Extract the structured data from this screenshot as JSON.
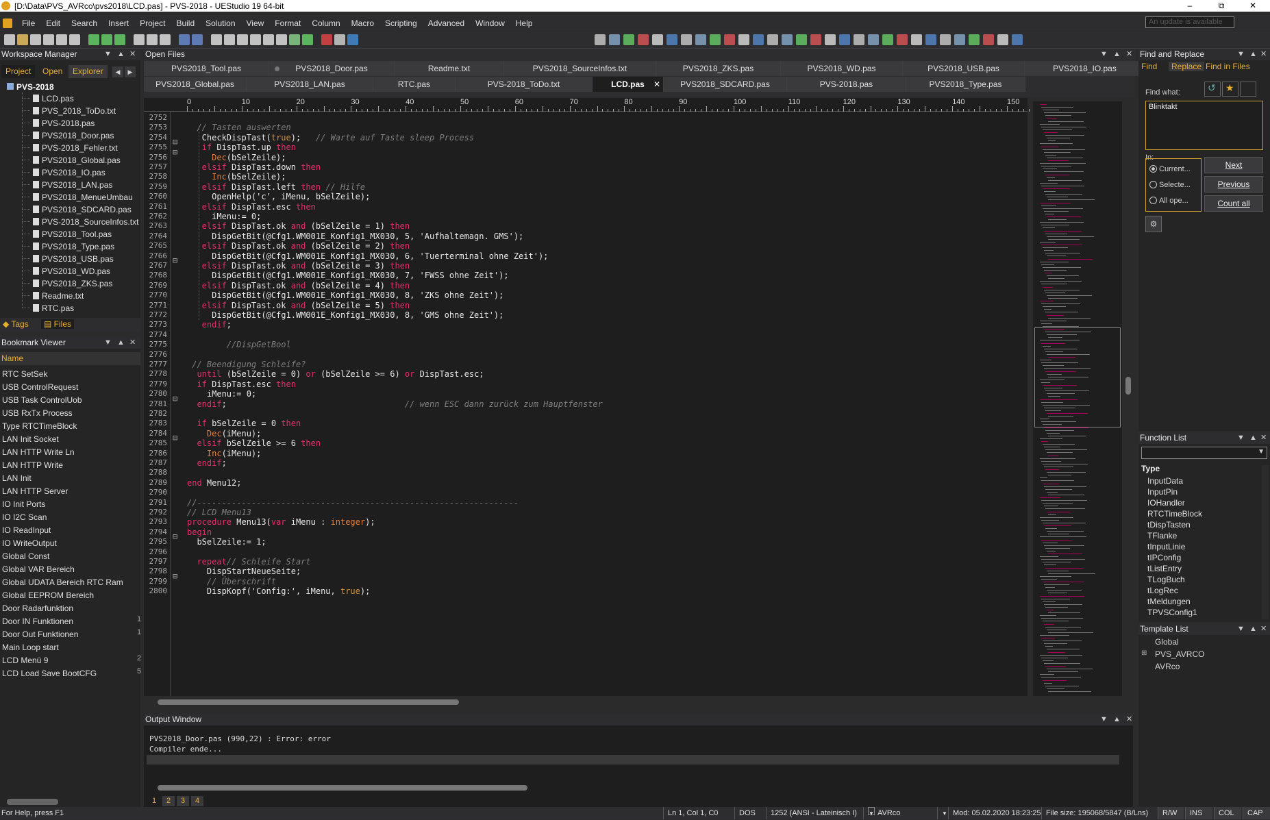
{
  "window": {
    "title": "[D:\\Data\\PVS_AVRco\\pvs2018\\LCD.pas] - PVS-2018 - UEStudio 19 64-bit",
    "banner": "An update is available"
  },
  "menu": [
    "File",
    "Edit",
    "Search",
    "Insert",
    "Project",
    "Build",
    "Solution",
    "View",
    "Format",
    "Column",
    "Macro",
    "Scripting",
    "Advanced",
    "Window",
    "Help"
  ],
  "workspace": {
    "title": "Workspace Manager",
    "tabs": [
      "Project",
      "Open",
      "Explorer"
    ],
    "root": "PVS-2018",
    "files": [
      "LCD.pas",
      "PVS_2018_ToDo.txt",
      "PVS-2018.pas",
      "PVS2018_Door.pas",
      "PVS-2018_Fehler.txt",
      "PVS2018_Global.pas",
      "PVS2018_IO.pas",
      "PVS2018_LAN.pas",
      "PVS2018_MenueUmbau",
      "PVS2018_SDCARD.pas",
      "PVS-2018_SourceInfos.txt",
      "PVS2018_Tool.pas",
      "PVS2018_Type.pas",
      "PVS2018_USB.pas",
      "PVS2018_WD.pas",
      "PVS2018_ZKS.pas",
      "Readme.txt",
      "RTC.pas"
    ],
    "bottom_tabs": [
      "Tags",
      "Files"
    ]
  },
  "bookmarks": {
    "title": "Bookmark Viewer",
    "column": "Name",
    "items": [
      "RTC SetSek",
      "USB ControlRequest",
      "USB Task ControlUob",
      "USB RxTx Process",
      "Type RTCTimeBlock",
      "LAN Init Socket",
      "LAN HTTP Write Ln",
      "LAN HTTP Write",
      "LAN Init",
      "LAN HTTP Server",
      "IO Init Ports",
      "IO I2C Scan",
      "IO ReadInput",
      "IO WriteOutput",
      "Global Const",
      "Global VAR Bereich",
      "Global UDATA Bereich RTC Ram",
      "Global EEPROM Bereich",
      "Door Radarfunktion",
      "Door IN Funktionen",
      "Door Out Funktionen",
      "Main Loop start",
      "LCD Menü 9",
      "LCD Load Save BootCFG"
    ],
    "counts": [
      "",
      "",
      "",
      "",
      "",
      "",
      "",
      "",
      "",
      "",
      "",
      "",
      "",
      "",
      "",
      "",
      "",
      "",
      "",
      "1",
      "1",
      "",
      "2",
      "5"
    ]
  },
  "openfiles": {
    "title": "Open Files",
    "row1": [
      "PVS2018_Tool.pas",
      "PVS2018_Door.pas",
      "Readme.txt",
      "PVS2018_SourceInfos.txt",
      "PVS2018_ZKS.pas",
      "PVS2018_WD.pas",
      "PVS2018_USB.pas",
      "PVS2018_IO.pas"
    ],
    "row2": [
      "PVS2018_Global.pas",
      "PVS2018_LAN.pas",
      "RTC.pas",
      "PVS-2018_ToDo.txt",
      "LCD.pas",
      "PVS2018_SDCARD.pas",
      "PVS-2018.pas",
      "PVS2018_Type.pas"
    ],
    "active": "LCD.pas"
  },
  "ruler": [
    "0",
    "10",
    "20",
    "30",
    "40",
    "50",
    "60",
    "70",
    "80",
    "90",
    "100",
    "110",
    "120",
    "130",
    "140",
    "150"
  ],
  "editor": {
    "first_line": 2752,
    "lines": [
      [],
      [
        [
          "cm",
          "  // Tasten auswerten"
        ]
      ],
      [
        [
          "fn",
          "   CheckDispTast("
        ],
        [
          "bool",
          "true"
        ],
        [
          "fn",
          ");   "
        ],
        [
          "cm",
          "// Warte auf Taste sleep Process"
        ]
      ],
      [
        [
          "kw",
          "   if "
        ],
        [
          "fn",
          "DispTast.up "
        ],
        [
          "kw",
          "then"
        ]
      ],
      [
        [
          "ty",
          "     Dec"
        ],
        [
          "fn",
          "(bSelZeile);"
        ]
      ],
      [
        [
          "kw",
          "   elsif "
        ],
        [
          "fn",
          "DispTast.down "
        ],
        [
          "kw",
          "then"
        ]
      ],
      [
        [
          "ty",
          "     Inc"
        ],
        [
          "fn",
          "(bSelZeile);"
        ]
      ],
      [
        [
          "kw",
          "   elsif "
        ],
        [
          "fn",
          "DispTast.left "
        ],
        [
          "kw",
          "then "
        ],
        [
          "cm",
          "// Hilfe"
        ]
      ],
      [
        [
          "fn",
          "     OpenHelp('c', iMenu, bSelZeile);"
        ]
      ],
      [
        [
          "kw",
          "   elsif "
        ],
        [
          "fn",
          "DispTast.esc "
        ],
        [
          "kw",
          "then"
        ]
      ],
      [
        [
          "fn",
          "     iMenu:= 0;"
        ]
      ],
      [
        [
          "kw",
          "   elsif "
        ],
        [
          "fn",
          "DispTast.ok "
        ],
        [
          "kw",
          "and "
        ],
        [
          "fn",
          "(bSelZeile = 1) "
        ],
        [
          "kw",
          "then"
        ]
      ],
      [
        [
          "fn",
          "     DispGetBit(@Cfg1.WM001E_Konfig1_MX030, 5, 'Aufhaltemagn. GMS');"
        ]
      ],
      [
        [
          "kw",
          "   elsif "
        ],
        [
          "fn",
          "DispTast.ok "
        ],
        [
          "kw",
          "and "
        ],
        [
          "fn",
          "(bSelZeile = 2) "
        ],
        [
          "kw",
          "then"
        ]
      ],
      [
        [
          "fn",
          "     DispGetBit(@Cfg1.WM001E_Konfig1_MX030, 6, 'Tuerterminal ohne Zeit');"
        ]
      ],
      [
        [
          "kw",
          "   elsif "
        ],
        [
          "fn",
          "DispTast.ok "
        ],
        [
          "kw",
          "and "
        ],
        [
          "fn",
          "(bSelZeile = 3) "
        ],
        [
          "kw",
          "then"
        ]
      ],
      [
        [
          "fn",
          "     DispGetBit(@Cfg1.WM001E_Konfig1_MX030, 7, 'FWSS ohne Zeit');"
        ]
      ],
      [
        [
          "kw",
          "   elsif "
        ],
        [
          "fn",
          "DispTast.ok "
        ],
        [
          "kw",
          "and "
        ],
        [
          "fn",
          "(bSelZeile = 4) "
        ],
        [
          "kw",
          "then"
        ]
      ],
      [
        [
          "fn",
          "     DispGetBit(@Cfg1.WM001E_Konfig1_MX030, 8, 'ZKS ohne Zeit');"
        ]
      ],
      [
        [
          "kw",
          "   elsif "
        ],
        [
          "fn",
          "DispTast.ok "
        ],
        [
          "kw",
          "and "
        ],
        [
          "fn",
          "(bSelZeile = 5) "
        ],
        [
          "kw",
          "then"
        ]
      ],
      [
        [
          "fn",
          "     DispGetBit(@Cfg1.WM001E_Konfig1_MX030, 8, 'GMS ohne Zeit');"
        ]
      ],
      [
        [
          "kw",
          "   endif"
        ],
        [
          "fn",
          ";"
        ]
      ],
      [],
      [
        [
          "cm",
          "        //DispGetBool"
        ]
      ],
      [],
      [
        [
          "cm",
          " // Beendigung Schleife?"
        ]
      ],
      [
        [
          "kw",
          "  until "
        ],
        [
          "fn",
          "(bSelZeile = 0) "
        ],
        [
          "kw",
          "or "
        ],
        [
          "fn",
          "(bSelZeile >= 6) "
        ],
        [
          "kw",
          "or "
        ],
        [
          "fn",
          "DispTast.esc;"
        ]
      ],
      [
        [
          "kw",
          "  if "
        ],
        [
          "fn",
          "DispTast.esc "
        ],
        [
          "kw",
          "then"
        ]
      ],
      [
        [
          "fn",
          "    iMenu:= 0;"
        ]
      ],
      [
        [
          "kw",
          "  endif"
        ],
        [
          "fn",
          ";                                    "
        ],
        [
          "cm",
          "// wenn ESC dann zurück zum Hauptfenster"
        ]
      ],
      [],
      [
        [
          "kw",
          "  if "
        ],
        [
          "fn",
          "bSelZeile = 0 "
        ],
        [
          "kw",
          "then"
        ]
      ],
      [
        [
          "ty",
          "    Dec"
        ],
        [
          "fn",
          "(iMenu);"
        ]
      ],
      [
        [
          "kw",
          "  elsif "
        ],
        [
          "fn",
          "bSelZeile >= 6 "
        ],
        [
          "kw",
          "then"
        ]
      ],
      [
        [
          "ty",
          "    Inc"
        ],
        [
          "fn",
          "(iMenu);"
        ]
      ],
      [
        [
          "kw",
          "  endif"
        ],
        [
          "fn",
          ";"
        ]
      ],
      [],
      [
        [
          "kw",
          "end "
        ],
        [
          "fn",
          "Menu12;"
        ]
      ],
      [],
      [
        [
          "cm",
          "//-----------------------------------------------------------------"
        ]
      ],
      [
        [
          "cm",
          "// LCD Menu13"
        ]
      ],
      [
        [
          "kw",
          "procedure "
        ],
        [
          "fn",
          "Menu13("
        ],
        [
          "kw",
          "var "
        ],
        [
          "fn",
          "iMenu : "
        ],
        [
          "ty",
          "integer"
        ],
        [
          "fn",
          ");"
        ]
      ],
      [
        [
          "kw",
          "begin"
        ]
      ],
      [
        [
          "fn",
          "  bSelZeile:= 1;"
        ]
      ],
      [],
      [
        [
          "kw",
          "  repeat"
        ],
        [
          "cm",
          "// Schleife Start"
        ]
      ],
      [
        [
          "fn",
          "    DispStartNeueSeite;"
        ]
      ],
      [
        [
          "cm",
          "    // Überschrift"
        ]
      ],
      [
        [
          "fn",
          "    DispKopf('Config:', iMenu, "
        ],
        [
          "bool",
          "true"
        ],
        [
          "fn",
          ");"
        ]
      ]
    ]
  },
  "output": {
    "title": "Output Window",
    "lines": [
      "PVS2018_Door.pas (990,22) : Error: error",
      "Compiler ende..."
    ],
    "tabs": [
      "1",
      "2",
      "3",
      "4"
    ]
  },
  "find": {
    "title": "Find and Replace",
    "tabs": [
      "Find",
      "Replace",
      "Find in Files"
    ],
    "find_what_label": "Find what:",
    "value": "Blinktakt",
    "in_label": "In:",
    "scopes": [
      "Current...",
      "Selecte...",
      "All ope..."
    ],
    "buttons": [
      "Next",
      "Previous",
      "Count all"
    ]
  },
  "functions": {
    "title": "Function List",
    "group": "Type",
    "items": [
      "InputData",
      "InputPin",
      "IOHandler",
      "RTCTimeBlock",
      "tDispTasten",
      "TFlanke",
      "tInputLinie",
      "tIPConfig",
      "tListEntry",
      "TLogBuch",
      "tLogRec",
      "tMeldungen",
      "TPVSConfig1"
    ]
  },
  "templates": {
    "title": "Template List",
    "items": [
      "Global",
      "PVS_AVRCO",
      "AVRco"
    ]
  },
  "status": {
    "help": "For Help, press F1",
    "pos": "Ln 1, Col 1, C0",
    "eol": "DOS",
    "enc": "1252  (ANSI - Lateinisch I)",
    "highlight": "AVRco",
    "mod": "Mod: 05.02.2020 18:23:25",
    "size": "File size: 195068/5847 (B/Lns)",
    "rw": "R/W",
    "ins": "INS",
    "col": "COL",
    "cap": "CAP"
  }
}
